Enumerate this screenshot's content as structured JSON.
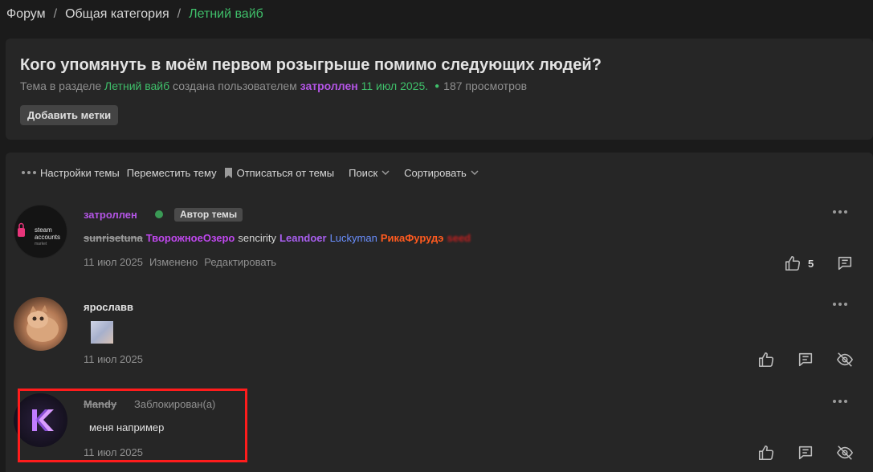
{
  "breadcrumb": {
    "items": [
      "Форум",
      "Общая категория",
      "Летний вайб"
    ],
    "separator": "/"
  },
  "thread": {
    "title": "Кого упомянуть в моём первом розыгрыше помимо следующих людей?",
    "meta_prefix": "Тема в разделе",
    "section": "Летний вайб",
    "meta_middle": "создана пользователем",
    "author": "затроллен",
    "date": "11 июл 2025.",
    "views": "187 просмотров",
    "add_tags_label": "Добавить метки"
  },
  "toolbar": {
    "settings": "Настройки темы",
    "move": "Переместить тему",
    "unsubscribe": "Отписаться от темы",
    "search": "Поиск",
    "sort": "Сортировать"
  },
  "posts": [
    {
      "username": "затроллен",
      "username_color": "#b455e6",
      "badge": "Автор темы",
      "avatar_text": [
        "steam",
        "accounts",
        "market"
      ],
      "signature": [
        {
          "text": "sunrisetuna",
          "style": "strike"
        },
        {
          "text": "ТворожноеОзеро",
          "style": "purple"
        },
        {
          "text": "sencirity",
          "style": "white"
        },
        {
          "text": "Leandoer",
          "style": "violet"
        },
        {
          "text": "Luckyman",
          "style": "blue"
        },
        {
          "text": "РикаФурудэ",
          "style": "orange"
        },
        {
          "text": "seed",
          "style": "red"
        }
      ],
      "date": "11 июл 2025",
      "edited": "Изменено",
      "edit": "Редактировать",
      "likes": "5"
    },
    {
      "username": "ярославв",
      "username_color": "#e0e0e0",
      "date": "11 июл 2025"
    },
    {
      "username": "Mandy",
      "username_color": "#8f8f8f",
      "status": "Заблокирован(а)",
      "message": "меня например",
      "date": "11 июл 2025"
    }
  ]
}
